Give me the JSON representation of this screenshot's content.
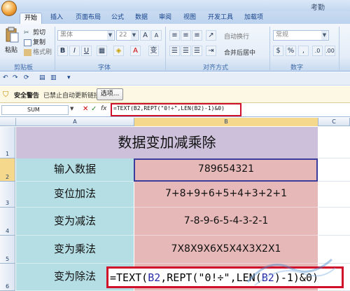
{
  "window": {
    "title": "考勤"
  },
  "tabs": [
    "开始",
    "插入",
    "页面布局",
    "公式",
    "数据",
    "审阅",
    "视图",
    "开发工具",
    "加载项"
  ],
  "ribbon": {
    "clipboard": {
      "paste": "粘贴",
      "cut": "剪切",
      "copy": "复制",
      "format_painter": "格式刷",
      "label": "剪贴板"
    },
    "font": {
      "font_name": "黑体",
      "font_size": "22",
      "bold": "B",
      "italic": "I",
      "underline": "U",
      "label": "字体"
    },
    "alignment": {
      "wrap": "自动换行",
      "merge": "合并后居中",
      "label": "对齐方式"
    },
    "number": {
      "format": "常规",
      "label": "数字"
    }
  },
  "security": {
    "title": "安全警告",
    "message": "已禁止自动更新链接",
    "options_label": "选项..."
  },
  "formula_bar": {
    "name_box": "SUM",
    "fx": "fx",
    "formula": "=TEXT(B2,REPT(\"0!÷\",LEN(B2)-1)&0)"
  },
  "columns": [
    "A",
    "B",
    "C"
  ],
  "rows": [
    {
      "num": "1",
      "title": "数据变加减乘除"
    },
    {
      "num": "2",
      "label": "输入数据",
      "value": "789654321"
    },
    {
      "num": "3",
      "label": "变位加法",
      "value": "7+8+9+6+5+4+3+2+1"
    },
    {
      "num": "4",
      "label": "变为减法",
      "value": "7-8-9-6-5-4-3-2-1"
    },
    {
      "num": "5",
      "label": "变为乘法",
      "value": "7X8X9X6X5X4X3X2X1"
    },
    {
      "num": "6",
      "label": "变为除法"
    }
  ],
  "cell_formula": {
    "prefix": "=TEXT(",
    "ref1": "B2",
    "mid": ",REPT(\"0!÷\",LEN(",
    "ref2": "B2",
    "suffix": ")-1)&0)"
  },
  "colors": {
    "title_fill": "#ccc0da",
    "label_fill": "#b4dde4",
    "value_fill": "#e6b8b8",
    "highlight": "#d0102a"
  }
}
